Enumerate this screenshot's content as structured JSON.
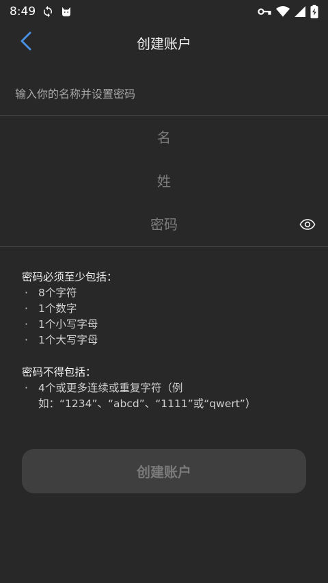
{
  "status_bar": {
    "time": "8:49",
    "icons": [
      "sync-icon",
      "cat-notification-icon",
      "vpn-key-icon",
      "wifi-icon",
      "cellular-signal-icon",
      "battery-charging-icon"
    ]
  },
  "app_bar": {
    "title": "创建账户",
    "back_icon": "chevron-left-icon"
  },
  "form": {
    "instruction": "输入你的名称并设置密码",
    "first_name_placeholder": "名",
    "first_name_value": "",
    "last_name_placeholder": "姓",
    "last_name_value": "",
    "password_placeholder": "密码",
    "password_value": "",
    "password_toggle_icon": "eye-icon"
  },
  "requirements": {
    "must_heading": "密码必须至少包括：",
    "must_items": [
      "8个字符",
      "1个数字",
      "1个小写字母",
      "1个大写字母"
    ],
    "must_not_heading": "密码不得包括：",
    "must_not_items": [
      "4个或更多连续或重复字符（例如：“1234”、“abcd”、“1111”或“qwert”）"
    ]
  },
  "submit": {
    "label": "创建账户"
  },
  "colors": {
    "background": "#282828",
    "accent": "#4a90e2",
    "button_disabled_bg": "#3f3f3f",
    "button_disabled_text": "#7a7a7a"
  }
}
